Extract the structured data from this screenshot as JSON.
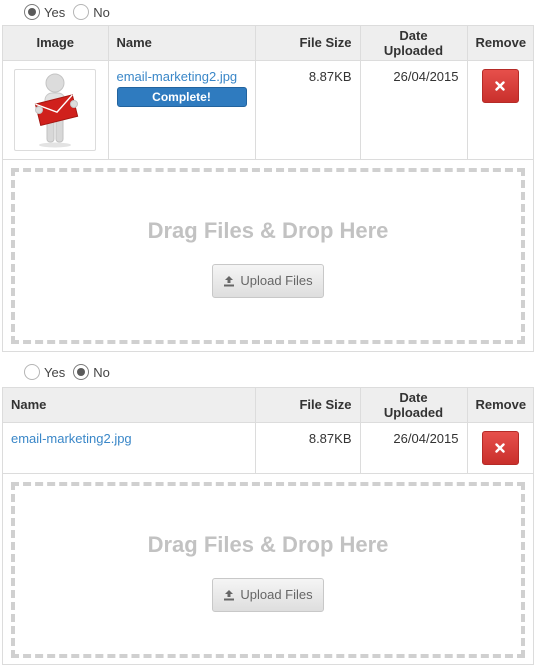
{
  "section1": {
    "radio": {
      "yes_label": "Yes",
      "no_label": "No",
      "selected": "yes"
    },
    "columns": {
      "image": "Image",
      "name": "Name",
      "size": "File Size",
      "date": "Date Uploaded",
      "remove": "Remove"
    },
    "files": [
      {
        "name": "email-marketing2.jpg",
        "status": "Complete!",
        "size": "8.87KB",
        "date": "26/04/2015"
      }
    ],
    "dropzone": {
      "title": "Drag Files & Drop Here",
      "button_label": "Upload Files"
    }
  },
  "section2": {
    "radio": {
      "yes_label": "Yes",
      "no_label": "No",
      "selected": "no"
    },
    "columns": {
      "name": "Name",
      "size": "File Size",
      "date": "Date Uploaded",
      "remove": "Remove"
    },
    "files": [
      {
        "name": "email-marketing2.jpg",
        "size": "8.87KB",
        "date": "26/04/2015"
      }
    ],
    "dropzone": {
      "title": "Drag Files & Drop Here",
      "button_label": "Upload Files"
    }
  },
  "icons": {
    "remove": "close-icon",
    "upload": "upload-icon",
    "thumbnail": "person-holding-envelope"
  },
  "colors": {
    "link": "#3a87c8",
    "progress": "#2f7bbf",
    "danger": "#d9534f",
    "dropzone_text": "#c2c2c2"
  }
}
